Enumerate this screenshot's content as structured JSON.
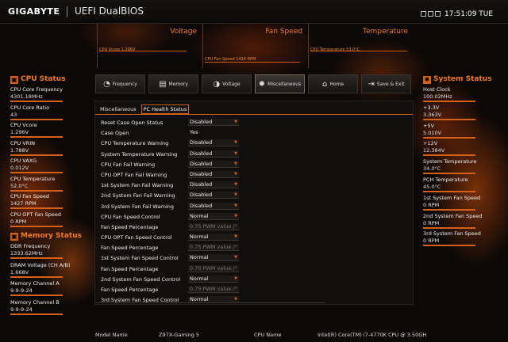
{
  "header": {
    "brand": "GIGABYTE",
    "product": "UEFI DualBIOS",
    "clock": "17:51:09 TUE"
  },
  "monitors": [
    {
      "title": "Voltage",
      "label": "CPU Vcore     1.296V"
    },
    {
      "title": "Fan Speed",
      "label": "CPU Fan Speed       1424 RPM"
    },
    {
      "title": "Temperature",
      "label": "CPU Temperature     53.0°C"
    }
  ],
  "cpu_status": {
    "title": "CPU Status",
    "items": [
      {
        "label": "CPU Core Frequency",
        "value": "4301.18MHz"
      },
      {
        "label": "CPU Core Ratio",
        "value": "43"
      },
      {
        "label": "CPU Vcore",
        "value": "1.296V"
      },
      {
        "label": "CPU VRIN",
        "value": "1.788V"
      },
      {
        "label": "CPU VAXG",
        "value": "0.012V"
      },
      {
        "label": "CPU Temperature",
        "value": "52.0°C"
      },
      {
        "label": "CPU Fan Speed",
        "value": "1427 RPM"
      },
      {
        "label": "CPU OPT Fan Speed",
        "value": "0 RPM"
      }
    ]
  },
  "memory_status": {
    "title": "Memory Status",
    "items": [
      {
        "label": "DDR Frequency",
        "value": "1333.62MHz"
      },
      {
        "label": "DRAM Voltage      (CH A/B)",
        "value": "1.668V"
      },
      {
        "label": "Memory Channel A",
        "value": "9-9-9-24"
      },
      {
        "label": "Memory Channel B",
        "value": "9-9-9-24"
      }
    ]
  },
  "system_status": {
    "title": "System Status",
    "items": [
      {
        "label": "Host Clock",
        "value": "100.02MHz"
      },
      {
        "label": "+3.3V",
        "value": "3.363V"
      },
      {
        "label": "+5V",
        "value": "5.010V"
      },
      {
        "label": "+12V",
        "value": "12.384V"
      },
      {
        "label": "System Temperature",
        "value": "34.0°C"
      },
      {
        "label": "PCH Temperature",
        "value": "45.0°C"
      },
      {
        "label": "1st System Fan Speed",
        "value": "0 RPM"
      },
      {
        "label": "2nd System Fan Speed",
        "value": "0 RPM"
      },
      {
        "label": "3rd System Fan Speed",
        "value": "0 RPM"
      }
    ]
  },
  "nav": [
    {
      "label": "Frequency",
      "icon": "frequency-icon",
      "glyph": "◔"
    },
    {
      "label": "Memory",
      "icon": "memory-icon",
      "glyph": "▤"
    },
    {
      "label": "Voltage",
      "icon": "voltage-icon",
      "glyph": "◑"
    },
    {
      "label": "Miscellaneous",
      "icon": "gear-icon",
      "glyph": "✹"
    },
    {
      "label": "Home",
      "icon": "home-icon",
      "glyph": "⌂"
    },
    {
      "label": "Save & Exit",
      "icon": "save-exit-icon",
      "glyph": "⇥"
    }
  ],
  "subtabs": [
    "Miscellaneous",
    "PC Health Status"
  ],
  "settings": [
    {
      "label": "Reset Case Open Status",
      "value": "Disabled",
      "style": "box"
    },
    {
      "label": "Case Open",
      "value": "Yes",
      "style": "plain"
    },
    {
      "label": "CPU Temperature Warning",
      "value": "Disabled",
      "style": "box"
    },
    {
      "label": "System Temperature Warning",
      "value": "Disabled",
      "style": "box"
    },
    {
      "label": "CPU Fan Fail Warning",
      "value": "Disabled",
      "style": "box"
    },
    {
      "label": "CPU OPT Fan Fail Warning",
      "value": "Disabled",
      "style": "box"
    },
    {
      "label": "1st System Fan Fail Warning",
      "value": "Disabled",
      "style": "box"
    },
    {
      "label": "2nd System Fan Fail Warning",
      "value": "Disabled",
      "style": "box"
    },
    {
      "label": "3rd System Fan Fail Warning",
      "value": "Disabled",
      "style": "box"
    },
    {
      "label": "CPU Fan Speed Control",
      "value": "Normal",
      "style": "box"
    },
    {
      "label": "Fan Speed Percentage",
      "value": "0.75 PWM value /°",
      "style": "dim"
    },
    {
      "label": "CPU OPT Fan Speed Control",
      "value": "Normal",
      "style": "box"
    },
    {
      "label": "Fan Speed Percentage",
      "value": "0.75 PWM value /°",
      "style": "dim"
    },
    {
      "label": "1st System Fan Speed Control",
      "value": "Normal",
      "style": "box"
    },
    {
      "label": "Fan Speed Percentage",
      "value": "0.75 PWM value /°",
      "style": "dim"
    },
    {
      "label": "2nd System Fan Speed Control",
      "value": "Normal",
      "style": "box"
    },
    {
      "label": "Fan Speed Percentage",
      "value": "0.75 PWM value /°",
      "style": "dim"
    },
    {
      "label": "3rd System Fan Speed Control",
      "value": "Normal",
      "style": "box"
    }
  ],
  "bottom": {
    "model_label": "Model Name",
    "model_value": "Z97X-Gaming 5",
    "cpu_label": "CPU Name",
    "cpu_value": "Intel(R) Core(TM) i7-4770K CPU @ 3.50GH"
  }
}
